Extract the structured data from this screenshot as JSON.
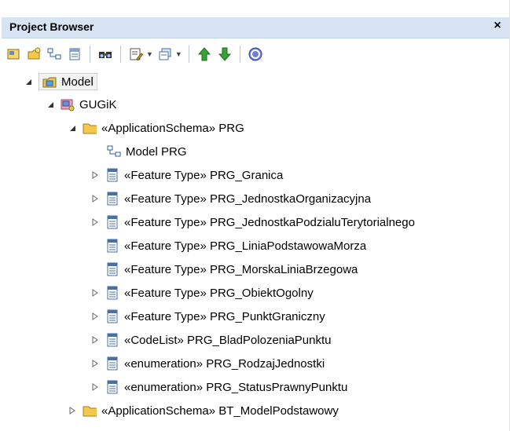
{
  "window": {
    "title": "Project Browser",
    "close": "×"
  },
  "toolbar": {
    "buttons": [
      "new-model-icon",
      "new-package-icon",
      "new-diagram-icon",
      "new-element-icon",
      "find-icon",
      "properties-icon",
      "views-icon",
      "move-up-icon",
      "move-down-icon",
      "help-icon"
    ]
  },
  "tree": {
    "model": "Model",
    "gugik": "GUGiK",
    "schema_prg": "«ApplicationSchema» PRG",
    "model_prg": "Model PRG",
    "items": [
      "«Feature Type» PRG_Granica",
      "«Feature Type» PRG_JednostkaOrganizacyjna",
      "«Feature Type» PRG_JednostkaPodzialuTerytorialnego",
      "«Feature Type» PRG_LiniaPodstawowaMorza",
      "«Feature Type» PRG_MorskaLiniaBrzegowa",
      "«Feature Type» PRG_ObiektOgolny",
      "«Feature Type» PRG_PunktGraniczny",
      "«CodeList» PRG_BladPolozeniaPunktu",
      "«enumeration» PRG_RodzajJednostki",
      "«enumeration» PRG_StatusPrawnyPunktu"
    ],
    "schema_bt": "«ApplicationSchema» BT_ModelPodstawowy"
  },
  "colors": {
    "title_bar": "#d6e4f4",
    "folder": "#f2c94c",
    "class_icon": "#4a6fa5"
  }
}
